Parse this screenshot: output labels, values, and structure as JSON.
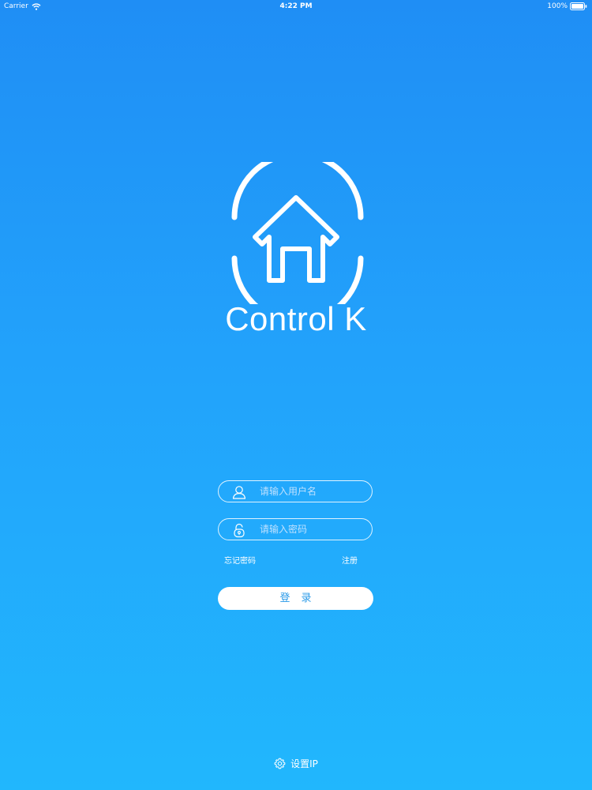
{
  "status_bar": {
    "carrier": "Carrier",
    "time": "4:22 PM",
    "battery": "100%"
  },
  "app": {
    "title": "Control K",
    "icon": "house-logo-icon"
  },
  "login_form": {
    "username_placeholder": "请输入用户名",
    "username_value": "",
    "password_placeholder": "请输入密码",
    "password_value": "",
    "forgot_password": "忘记密码",
    "register": "注册",
    "login_button": "登录"
  },
  "footer": {
    "settings_label": "设置IP",
    "settings_icon": "gear-icon"
  },
  "colors": {
    "background_top": "#1f8ef5",
    "background_bottom": "#21b7fd",
    "button_text": "#2a9ae8"
  }
}
